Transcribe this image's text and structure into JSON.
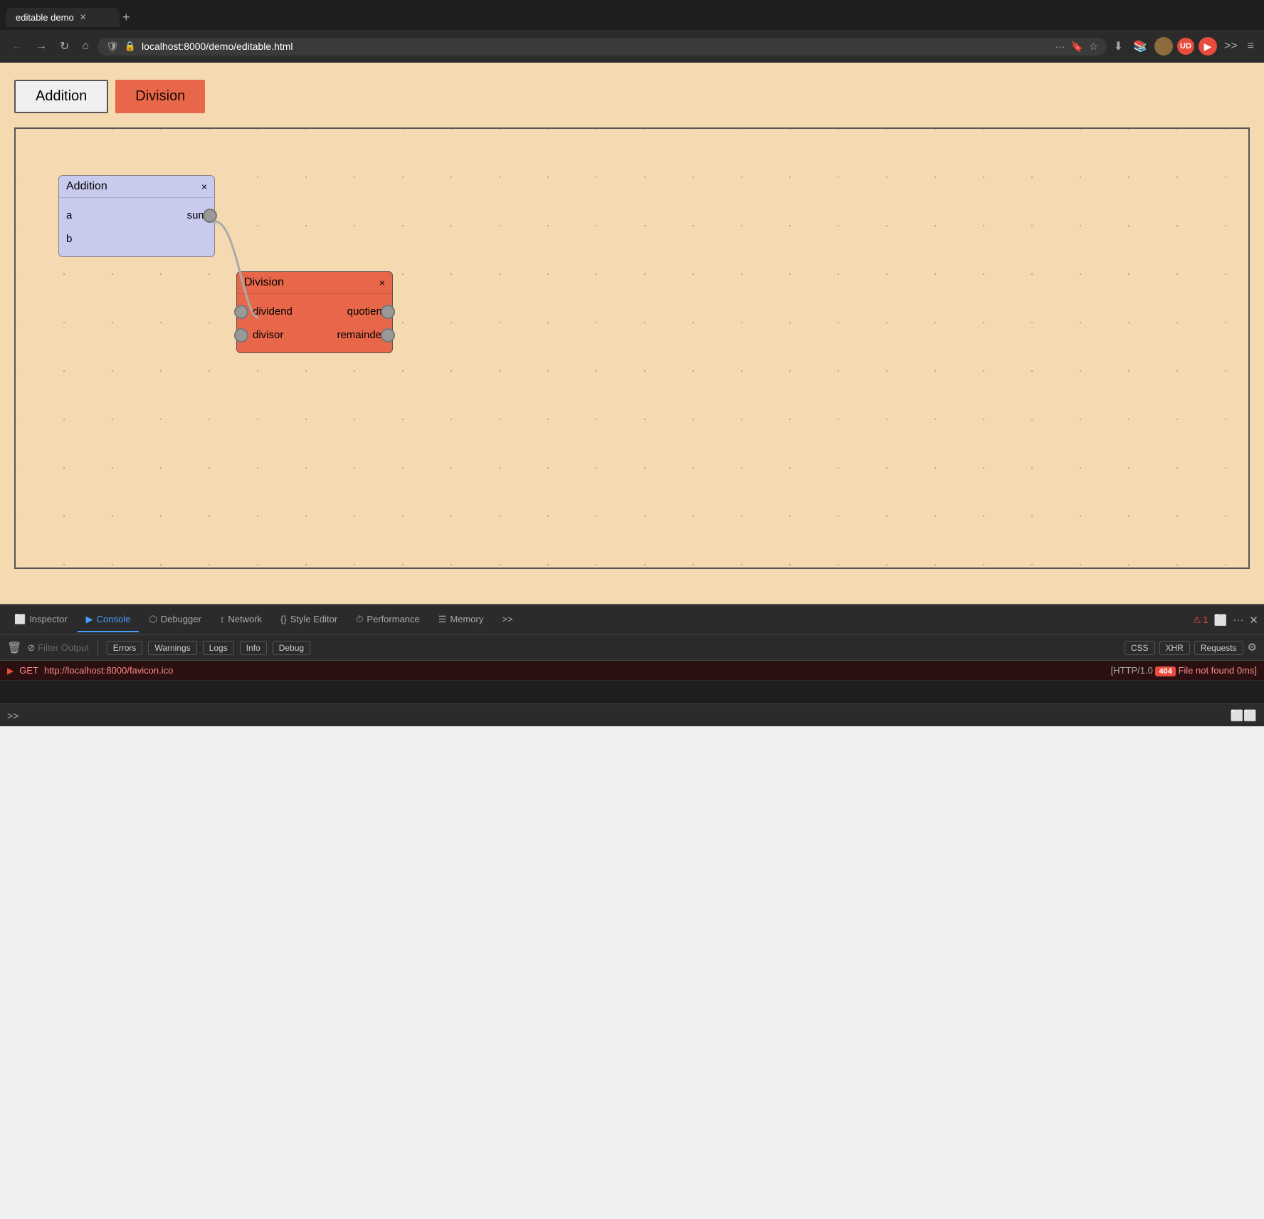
{
  "browser": {
    "tab_title": "editable demo",
    "url": "localhost:8000/demo/editable.html",
    "new_tab_label": "+"
  },
  "toolbar": {
    "addition_label": "Addition",
    "division_label": "Division"
  },
  "nodes": {
    "addition": {
      "title": "Addition",
      "close": "×",
      "inputs": [
        "a",
        "b"
      ],
      "outputs": [
        "sum"
      ]
    },
    "division": {
      "title": "Division",
      "close": "×",
      "inputs": [
        "dividend",
        "divisor"
      ],
      "outputs": [
        "quotient",
        "remainder"
      ]
    }
  },
  "devtools": {
    "tabs": [
      {
        "label": "Inspector",
        "icon": "🔍",
        "active": false
      },
      {
        "label": "Console",
        "icon": "▶",
        "active": true
      },
      {
        "label": "Debugger",
        "icon": "⬡",
        "active": false
      },
      {
        "label": "Network",
        "icon": "↕",
        "active": false
      },
      {
        "label": "Style Editor",
        "icon": "{}",
        "active": false
      },
      {
        "label": "Performance",
        "icon": "⏱",
        "active": false
      },
      {
        "label": "Memory",
        "icon": "☰",
        "active": false
      }
    ],
    "filter_placeholder": "Filter Output",
    "filter_buttons": [
      "Errors",
      "Warnings",
      "Logs",
      "Info",
      "Debug"
    ],
    "filter_buttons_right": [
      "CSS",
      "XHR",
      "Requests"
    ],
    "error_count": "1",
    "log_entries": [
      {
        "type": "error",
        "method": "GET",
        "url": "http://localhost:8000/favicon.ico",
        "status_text": "[HTTP/1.0",
        "status_code": "404",
        "status_msg": "File not found 0ms]"
      }
    ]
  }
}
